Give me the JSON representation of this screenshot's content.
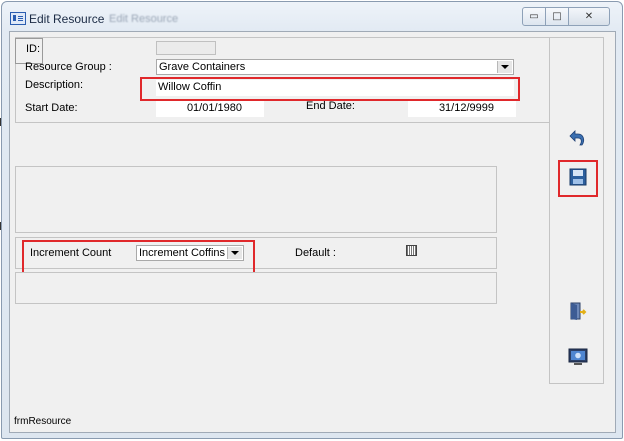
{
  "window": {
    "title": "Edit Resource",
    "title_ghost": "Edit Resource",
    "minimize_glyph": "▭",
    "maximize_glyph": "□",
    "close_glyph": "✕"
  },
  "form": {
    "id_label": "ID:",
    "id_value": "",
    "resource_group_label": "Resource Group :",
    "resource_group_value": "Grave Containers",
    "description_label": "Description:",
    "description_value": "Willow Coffin",
    "start_date_label": "Start Date:",
    "start_date_value": "01/01/1980",
    "end_date_label": "End Date:",
    "end_date_value": "31/12/9999"
  },
  "increment": {
    "label": "Increment Count",
    "value": "Increment Coffins",
    "default_label": "Default :"
  },
  "toolbar": {
    "icons": [
      "undo-icon",
      "save-icon",
      "exit-door-icon",
      "monitor-icon"
    ]
  },
  "footer": {
    "form_name": "frmResource"
  },
  "colors": {
    "highlight": "#e0282b",
    "window_bg": "#f0f0f0"
  }
}
